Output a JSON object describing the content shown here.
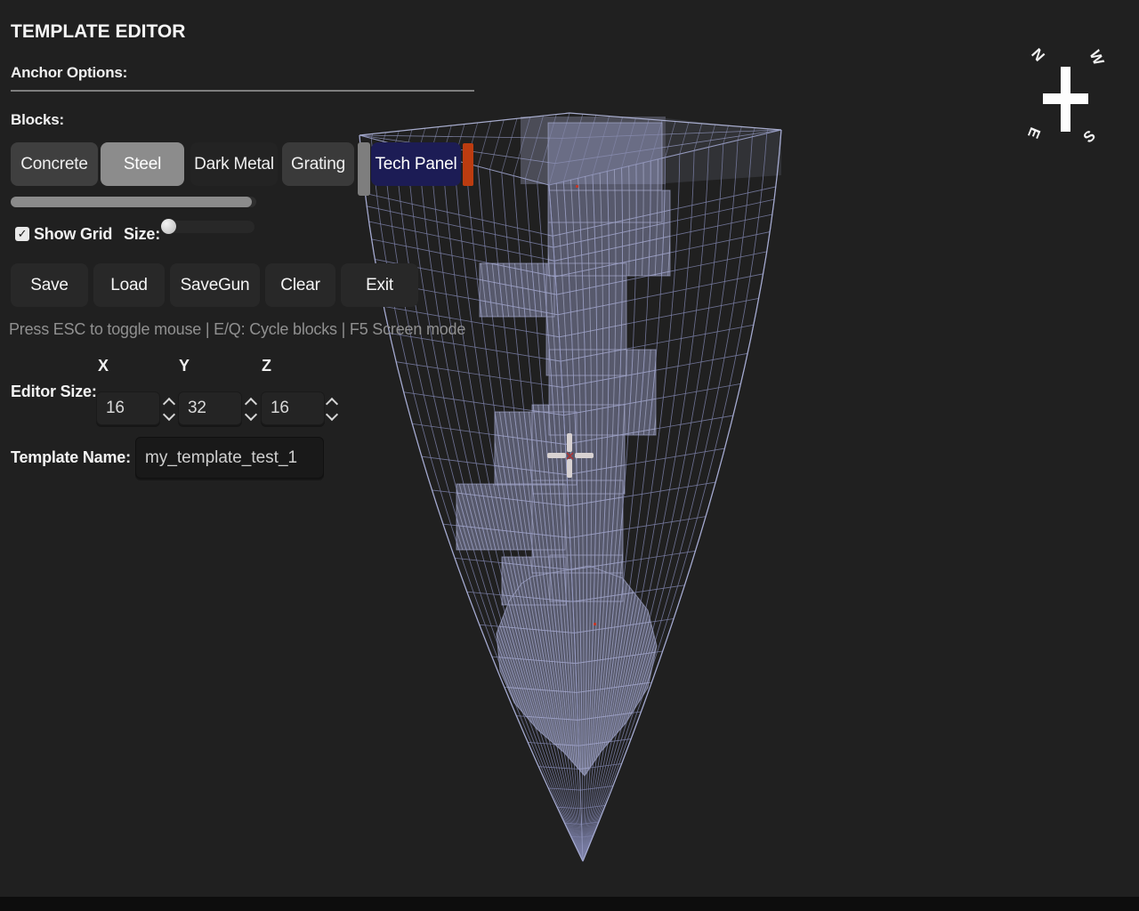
{
  "window": {
    "title": "TEMPLATE EDITOR"
  },
  "sections": {
    "anchor_options": "Anchor Options:",
    "blocks": "Blocks:"
  },
  "blocks": {
    "buttons": [
      {
        "label": "Concrete",
        "state": "normal"
      },
      {
        "label": "Steel",
        "state": "selected"
      },
      {
        "label": "Dark Metal",
        "state": "normal"
      },
      {
        "label": "Grating",
        "state": "normal"
      },
      {
        "label": "Tech Panel",
        "state": "active"
      }
    ]
  },
  "grid_controls": {
    "show_grid_label": "Show Grid",
    "checked": true,
    "checkmark": "✓",
    "size_label": "Size:"
  },
  "actions": {
    "save": "Save",
    "load": "Load",
    "savegun": "SaveGun",
    "clear": "Clear",
    "exit": "Exit"
  },
  "help_text": "Press ESC to toggle mouse | E/Q: Cycle blocks | F5 Screen mode",
  "editor_size": {
    "label": "Editor Size:",
    "x_label": "X",
    "y_label": "Y",
    "z_label": "Z",
    "x_value": "16",
    "y_value": "32",
    "z_value": "16"
  },
  "template": {
    "label": "Template Name:",
    "value": "my_template_test_1"
  },
  "compass": {
    "north": "N",
    "west": "W",
    "east": "E",
    "south": "S"
  },
  "colors": {
    "accent_orange": "#bc3c10",
    "active_navy": "#1c1c55",
    "selected_steel": "#8c8c8c",
    "wireframe": "#7b80a6",
    "voxel_fill": "#8589ac"
  }
}
